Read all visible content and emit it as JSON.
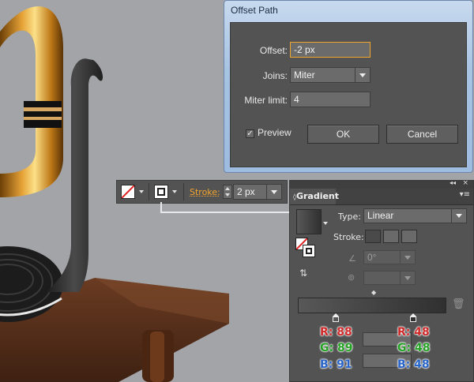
{
  "colors": {
    "canvas": "#a3a4a8",
    "panel": "#535353",
    "accent_orange": "#f3a52e",
    "title_blue": "#a8c4e3",
    "red_label": "#d02a2a",
    "green_label": "#23a223",
    "blue_label": "#2a66c9"
  },
  "offset_dialog": {
    "title": "Offset Path",
    "offset_label": "Offset:",
    "offset_value": "-2 px",
    "joins_label": "Joins:",
    "joins_value": "Miter",
    "miter_label": "Miter limit:",
    "miter_value": "4",
    "preview_label": "Preview",
    "preview_checked": true,
    "ok_label": "OK",
    "cancel_label": "Cancel"
  },
  "control_bar": {
    "stroke_label": "Stroke:",
    "stroke_value": "2 px",
    "icons": [
      "fill-none-swatch-icon",
      "stroke-swatch-icon",
      "stepper-icon"
    ]
  },
  "gradient_panel": {
    "tab_label": "Gradient",
    "type_label": "Type:",
    "type_value": "Linear",
    "stroke_label": "Stroke:",
    "angle_value": "0°",
    "aspect_value": "",
    "gradient_start_color": "#585858",
    "gradient_end_color": "#303030",
    "stop_left": {
      "r_label": "R:",
      "r": "88",
      "g_label": "G:",
      "g": "89",
      "b_label": "B:",
      "b": "91"
    },
    "stop_right": {
      "r_label": "R:",
      "r": "48",
      "g_label": "G:",
      "g": "48",
      "b_label": "B:",
      "b": "48"
    },
    "icons": [
      "collapse-icon",
      "close-icon",
      "panel-menu-icon",
      "delete-stop-icon",
      "angle-icon",
      "aspect-ratio-icon",
      "reverse-gradient-icon"
    ]
  }
}
